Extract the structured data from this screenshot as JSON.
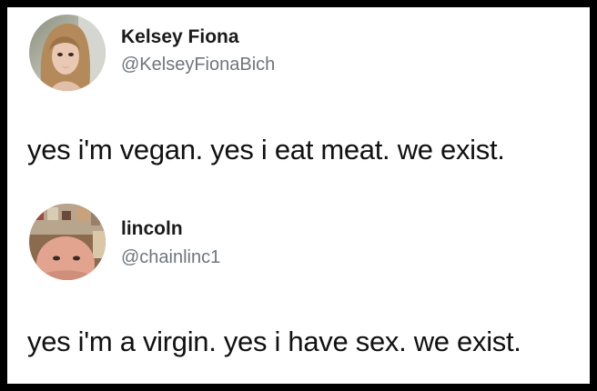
{
  "tweets": [
    {
      "display_name": "Kelsey Fiona",
      "handle": "@KelseyFionaBich",
      "text": "yes i'm vegan. yes i eat meat. we exist.",
      "avatar_icon": "profile-photo-woman"
    },
    {
      "display_name": "lincoln",
      "handle": "@chainlinc1",
      "text": "yes i'm a virgin. yes i have sex. we exist.",
      "avatar_icon": "profile-photo-man"
    }
  ],
  "colors": {
    "border": "#000000",
    "background": "#ffffff",
    "name": "#1a1a1a",
    "handle": "#6e767d",
    "text": "#111111"
  }
}
